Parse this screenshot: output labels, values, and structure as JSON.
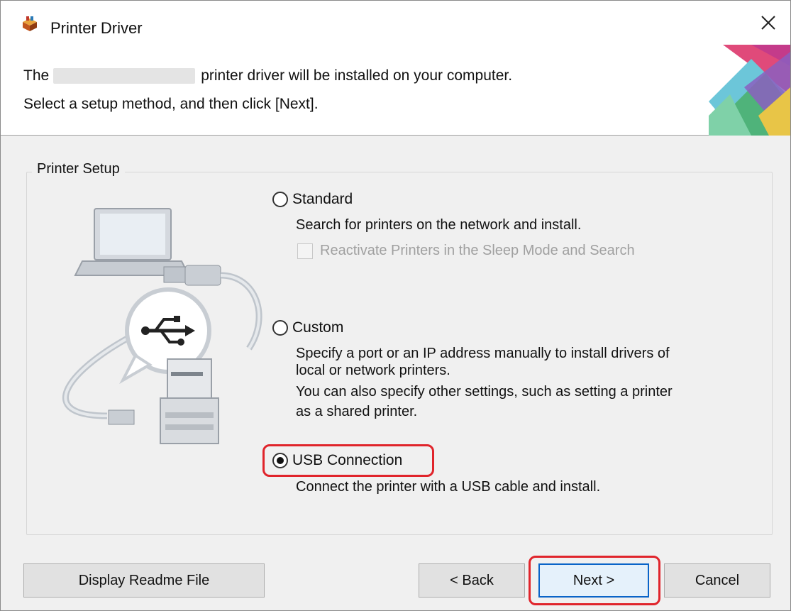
{
  "window": {
    "title": "Printer Driver",
    "close_glyph": "✕"
  },
  "header": {
    "line1_prefix": "The",
    "line1_suffix": "printer driver will be installed on your computer.",
    "line2": "Select a setup method, and then click [Next]."
  },
  "setup": {
    "group_label": "Printer Setup",
    "options": [
      {
        "label": "Standard",
        "selected": false,
        "description": [
          "Search for printers on the network and install."
        ],
        "sub_checkbox": {
          "label": "Reactivate Printers in the Sleep Mode and Search",
          "checked": false,
          "enabled": false
        }
      },
      {
        "label": "Custom",
        "selected": false,
        "description": [
          "Specify a port or an IP address manually to install drivers of",
          "local or network printers.",
          "You can also specify other settings, such as setting a printer",
          "as a shared printer."
        ]
      },
      {
        "label": "USB Connection",
        "selected": true,
        "description": [
          "Connect the printer with a USB cable and install."
        ]
      }
    ]
  },
  "buttons": {
    "readme": "Display Readme File",
    "back": "< Back",
    "next": "Next >",
    "cancel": "Cancel"
  },
  "colors": {
    "highlight": "#e0242b",
    "default_button_border": "#0a64c8",
    "dialog_bg": "#f0f0f0"
  },
  "icons": [
    "printer-driver-app-icon",
    "close-icon",
    "laptop-usb-printer-illustration",
    "usb-symbol-icon",
    "banner-graphic"
  ]
}
